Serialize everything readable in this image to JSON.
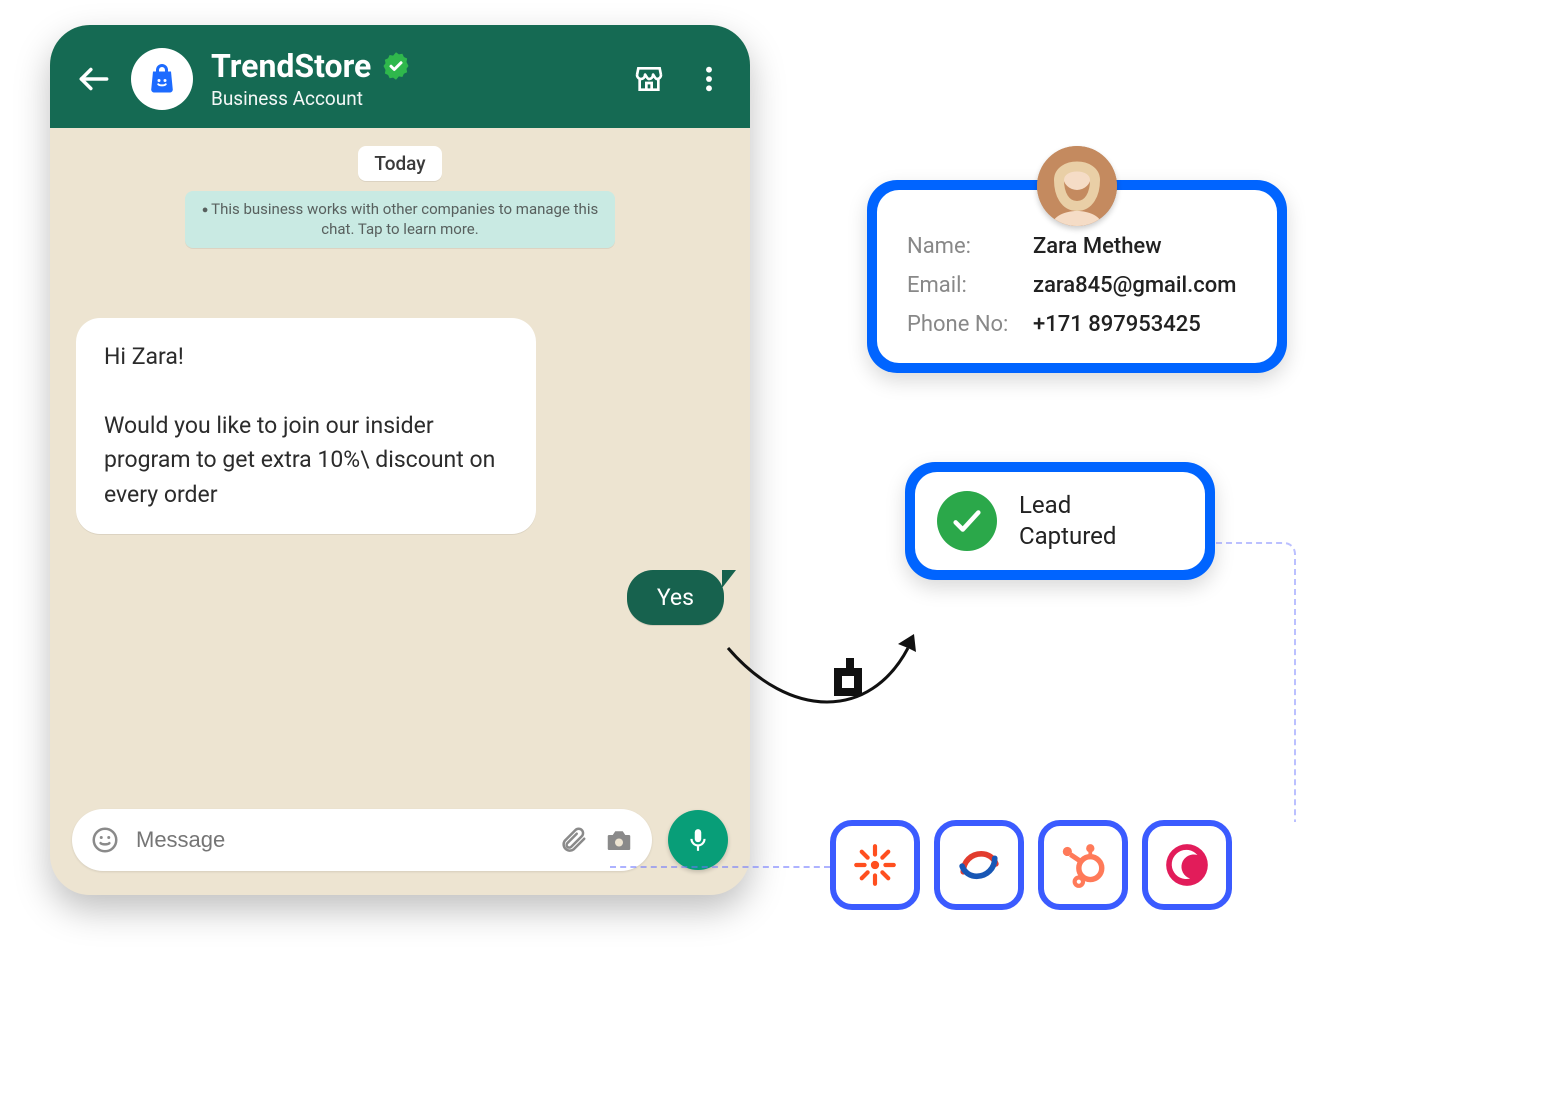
{
  "chat": {
    "header": {
      "title": "TrendStore",
      "subtitle": "Business Account"
    },
    "date_label": "Today",
    "system_notice": "This business works with other companies to manage this chat. Tap to learn more.",
    "incoming_message": "Hi Zara!\n\nWould you like to join our insider program to get extra 10%\\ discount on every order",
    "outgoing_message": "Yes",
    "composer_placeholder": "Message"
  },
  "lead": {
    "labels": {
      "name": "Name:",
      "email": "Email:",
      "phone": "Phone No:"
    },
    "name": "Zara Methew",
    "email": "zara845@gmail.com",
    "phone": "+171 897953425",
    "captured_text": "Lead\nCaptured"
  },
  "integrations": [
    "zapier-icon",
    "zoho-icon",
    "hubspot-icon",
    "crescent-icon"
  ]
}
